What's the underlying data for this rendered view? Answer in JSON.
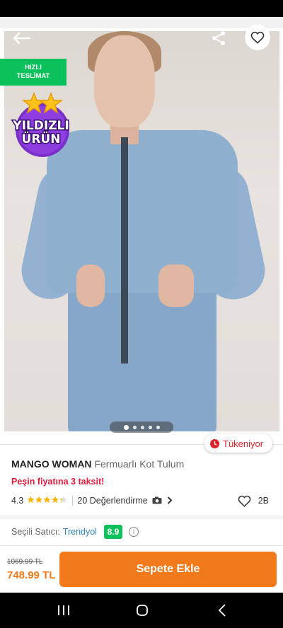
{
  "header": {
    "back_icon": "arrow-left-icon",
    "share_icon": "share-icon",
    "favorite_icon": "heart-outline-icon"
  },
  "badges": {
    "fast_delivery": "HIZLI\nTESLİMAT",
    "starred_line1": "YILDIZLI",
    "starred_line2": "ÜRÜN",
    "stock_status": "Tükeniyor"
  },
  "gallery": {
    "image_count": 5,
    "active_index": 0
  },
  "product": {
    "brand": "MANGO WOMAN",
    "name": "Fermuarlı Kot Tulum",
    "promo": "Peşin fiyatına 3 taksit!",
    "rating": "4.3",
    "rating_value": 4.3,
    "reviews": "20 Değerlendirme",
    "favorites": "2B"
  },
  "seller": {
    "label": "Seçili Satıcı:",
    "name": "Trendyol",
    "score": "8.9"
  },
  "cart": {
    "old_price": "1069.99 TL",
    "price": "748.99 TL",
    "button": "Sepete Ekle"
  },
  "colors": {
    "accent": "#f27a1a",
    "green": "#0bc15c",
    "promo_red": "#e31b3c",
    "seller_blue": "#2f84c1",
    "badge_purple": "#7a2fc9"
  }
}
